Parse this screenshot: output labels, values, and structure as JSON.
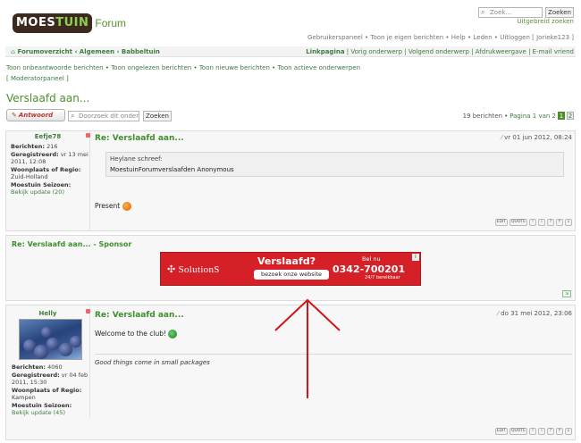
{
  "header": {
    "logo_main": "MOES",
    "logo_accent": "TUIN",
    "logo_suffix": "Forum",
    "search_placeholder": "Zoek...",
    "search_button": "Zoeken",
    "advanced_search": "Uitgebreid zoeken",
    "user_menu": [
      "Gebruikerspaneel",
      "Toon je eigen berichten",
      "Help",
      "Leden",
      "Uitloggen [ Jorieke123 ]"
    ]
  },
  "nav": {
    "breadcrumb": [
      "Forumoverzicht",
      "Algemeen",
      "Babbeltuin"
    ],
    "tools": [
      "Linkpagina",
      "Vorig onderwerp",
      "Volgend onderwerp",
      "Afdrukweergave",
      "E-mail vriend"
    ],
    "sublinks": [
      "Toon onbeantwoorde berichten",
      "Toon ongelezen berichten",
      "Toon nieuwe berichten",
      "Toon actieve onderwerpen"
    ],
    "mod_panel": "[ Moderatorpaneel ]"
  },
  "topic": {
    "title": "Verslaafd aan...",
    "reply_button": "Antwoord",
    "search_placeholder": "Doorzoek dit onderwerp...",
    "search_button": "Zoeken",
    "post_count": "19 berichten",
    "page_label": "Pagina 1 van 2",
    "pages": [
      "1",
      "2"
    ]
  },
  "posts": [
    {
      "author": "Eefje78",
      "berichten_label": "Berichten:",
      "berichten": "216",
      "geregistreerd_label": "Geregistreerd:",
      "geregistreerd": "vr 13 mei 2011, 12:08",
      "woonplaats_label": "Woonplaats of Regio:",
      "woonplaats": "Zuid-Holland",
      "seizoen_label": "Moestuin Seizoen:",
      "seizoen_link": "Bekijk update (20)",
      "title": "Re: Verslaafd aan...",
      "date": "vr 01 jun 2012, 08:24",
      "quote_author": "Heylane schreef:",
      "quote_text": "MoestuinForumverslaafden Anonymous",
      "text": "Present"
    },
    {
      "author": "Helly",
      "berichten_label": "Berichten:",
      "berichten": "4060",
      "geregistreerd_label": "Geregistreerd:",
      "geregistreerd": "vr 04 feb 2011, 15:30",
      "woonplaats_label": "Woonplaats of Regio:",
      "woonplaats": "Kampen",
      "seizoen_label": "Moestuin Seizoen:",
      "seizoen_link": "Bekijk update (45)",
      "title": "Re: Verslaafd aan...",
      "date": "do 31 mei 2012, 23:06",
      "text": "Welcome to the club!",
      "signature": "Good things come in small packages"
    }
  ],
  "sponsor": {
    "title": "Re: Verslaafd aan... - Sponsor",
    "ad_logo": "SolutionS",
    "ad_title": "Verslaafd?",
    "ad_cta": "bezoek onze website",
    "ad_bel": "Bel nu",
    "ad_phone": "0342-700201",
    "ad_bereik": "24/7 bereikbaar"
  },
  "actions": [
    "EDIT",
    "QUOTE",
    "!",
    "i",
    "?",
    "↑",
    "↓"
  ],
  "colors": {
    "brand_green": "#4a8f2a",
    "link_green": "#3f7a3f",
    "ad_red": "#d52027",
    "logo_brown": "#3d2a1f",
    "arrow_red": "#d4141b"
  }
}
